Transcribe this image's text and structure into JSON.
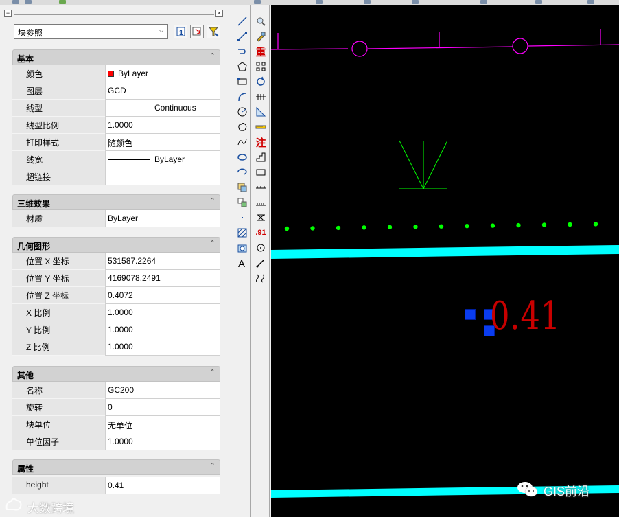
{
  "palette": {
    "object_type": "块参照",
    "close_glyph": "×",
    "collapse_glyph": "−"
  },
  "sections": {
    "basic": {
      "title": "基本",
      "rows": [
        {
          "name": "颜色",
          "value": "ByLayer"
        },
        {
          "name": "图层",
          "value": "GCD"
        },
        {
          "name": "线型",
          "value": "Continuous"
        },
        {
          "name": "线型比例",
          "value": "1.0000"
        },
        {
          "name": "打印样式",
          "value": "随颜色"
        },
        {
          "name": "线宽",
          "value": "ByLayer"
        },
        {
          "name": "超链接",
          "value": ""
        }
      ]
    },
    "threed": {
      "title": "三维效果",
      "rows": [
        {
          "name": "材质",
          "value": "ByLayer"
        }
      ]
    },
    "geometry": {
      "title": "几何图形",
      "rows": [
        {
          "name": "位置 X 坐标",
          "value": "531587.2264"
        },
        {
          "name": "位置 Y 坐标",
          "value": "4169078.2491"
        },
        {
          "name": "位置 Z 坐标",
          "value": "0.4072"
        },
        {
          "name": "X 比例",
          "value": "1.0000"
        },
        {
          "name": "Y 比例",
          "value": "1.0000"
        },
        {
          "name": "Z 比例",
          "value": "1.0000"
        }
      ]
    },
    "misc": {
      "title": "其他",
      "rows": [
        {
          "name": "名称",
          "value": "GC200"
        },
        {
          "name": "旋转",
          "value": "0"
        },
        {
          "name": "块单位",
          "value": "无单位"
        },
        {
          "name": "单位因子",
          "value": "1.0000"
        }
      ]
    },
    "attributes": {
      "title": "属性",
      "rows": [
        {
          "name": "height",
          "value": "0.41"
        }
      ]
    }
  },
  "colors": {
    "canvas_bg": "#000000",
    "magenta_line": "#ff00ff",
    "green_symbol": "#00ff00",
    "cyan_band": "#00ffff",
    "annotation_text": "#c80000",
    "grip": "#0a3cf0",
    "color_swatch": "#ff0000"
  },
  "icons": {
    "strip1": [
      "line-icon",
      "polyline-icon",
      "arc-polyline-icon",
      "polygon-icon",
      "rectangle-icon",
      "arc-icon",
      "circle-icon",
      "revision-cloud-icon",
      "spline-icon",
      "ellipse-icon",
      "ellipse-arc-icon",
      "insert-block-icon",
      "make-block-icon",
      "point-icon",
      "hatch-icon",
      "region-icon",
      "multiline-text-icon"
    ],
    "strip2": [
      "search-icon",
      "match-props-icon",
      "heavy-text-icon",
      "grid-icon",
      "refresh-icon",
      "dimension-chain-icon",
      "measure-icon",
      "scale-bar-icon",
      "annotate-text-icon",
      "stair-icon",
      "rectangle-icon",
      "dim-ticks-icon",
      "dim-ticks-icon",
      "cross-section-icon",
      "elevation-icon",
      "circle-dot-icon",
      "leader-icon",
      "break-line-icon"
    ]
  },
  "canvas": {
    "annotation": "0.41"
  },
  "watermarks": {
    "bottom_left": "大数跨境",
    "bottom_right": "GIS前沿"
  },
  "strip2_labels": {
    "heavy": "重",
    "annotate": "注",
    "elev": ".91"
  }
}
